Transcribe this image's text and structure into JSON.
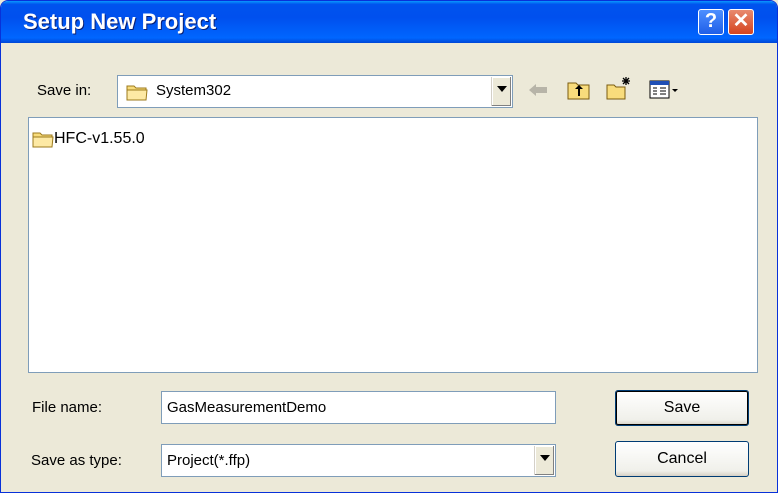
{
  "dialog": {
    "title": "Setup New Project",
    "help_glyph": "?",
    "close_glyph": "✕"
  },
  "save_in": {
    "label": "Save in:",
    "value": "System302",
    "icon": "folder-icon"
  },
  "toolbar": {
    "back_icon": "back-arrow-icon",
    "up_icon": "up-one-level-icon",
    "new_folder_icon": "new-folder-icon",
    "view_menu_icon": "view-menu-icon"
  },
  "file_list": {
    "items": [
      {
        "name": "HFC-v1.55.0",
        "icon": "folder-icon"
      }
    ]
  },
  "file_name": {
    "label": "File name:",
    "value": "GasMeasurementDemo"
  },
  "save_as_type": {
    "label": "Save as type:",
    "value": "Project(*.ffp)"
  },
  "buttons": {
    "save": "Save",
    "cancel": "Cancel"
  },
  "colors": {
    "titlebar": "#0053ee",
    "dialog_bg": "#ece9d8",
    "close_button": "#d5441f",
    "field_border": "#7f9db9"
  }
}
